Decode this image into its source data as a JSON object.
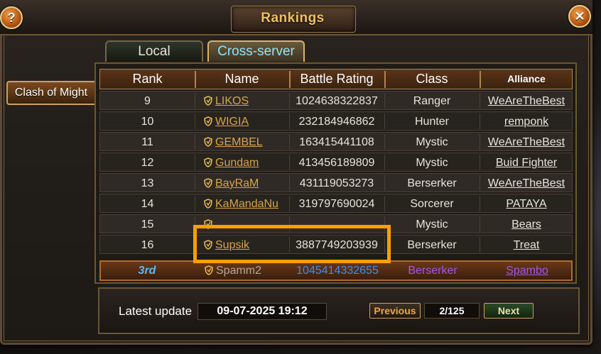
{
  "window": {
    "title": "Rankings"
  },
  "controls": {
    "help": "?",
    "close": "✕"
  },
  "tabs": [
    {
      "label": "Local",
      "active": false
    },
    {
      "label": "Cross-server",
      "active": true
    }
  ],
  "sidebar": {
    "item": "Clash of Might"
  },
  "table": {
    "headers": [
      "Rank",
      "Name",
      "Battle Rating",
      "Class",
      "Alliance"
    ],
    "rows": [
      {
        "rank": "9",
        "name": "LIKOS",
        "battle_rating": "1024638322837",
        "class": "Ranger",
        "alliance": "WeAreTheBest"
      },
      {
        "rank": "10",
        "name": "WIGIA",
        "battle_rating": "232184946862",
        "class": "Hunter",
        "alliance": "remponk"
      },
      {
        "rank": "11",
        "name": "GEMBEL",
        "battle_rating": "163415441108",
        "class": "Mystic",
        "alliance": "WeAreTheBest"
      },
      {
        "rank": "12",
        "name": "Gundam",
        "battle_rating": "413456189809",
        "class": "Mystic",
        "alliance": "Buid Fighter"
      },
      {
        "rank": "13",
        "name": "BayRaM",
        "battle_rating": "431119053273",
        "class": "Berserker",
        "alliance": "WeAreTheBest"
      },
      {
        "rank": "14",
        "name": "KaMandaNu",
        "battle_rating": "319797690024",
        "class": "Sorcerer",
        "alliance": "PATAYA"
      },
      {
        "rank": "15",
        "name": "",
        "battle_rating": "",
        "class": "Mystic",
        "alliance": "Bears"
      },
      {
        "rank": "16",
        "name": "Supsik",
        "battle_rating": "3887749203939",
        "class": "Berserker",
        "alliance": "Treat"
      }
    ],
    "self_row": {
      "rank": "3rd",
      "name": "Spamm2",
      "battle_rating": "1045414332655",
      "class": "Berserker",
      "alliance": "Spambo"
    }
  },
  "footer": {
    "latest_label": "Latest update",
    "latest_value": "09-07-2025 19:12",
    "previous": "Previous",
    "page": "2/125",
    "next": "Next"
  }
}
